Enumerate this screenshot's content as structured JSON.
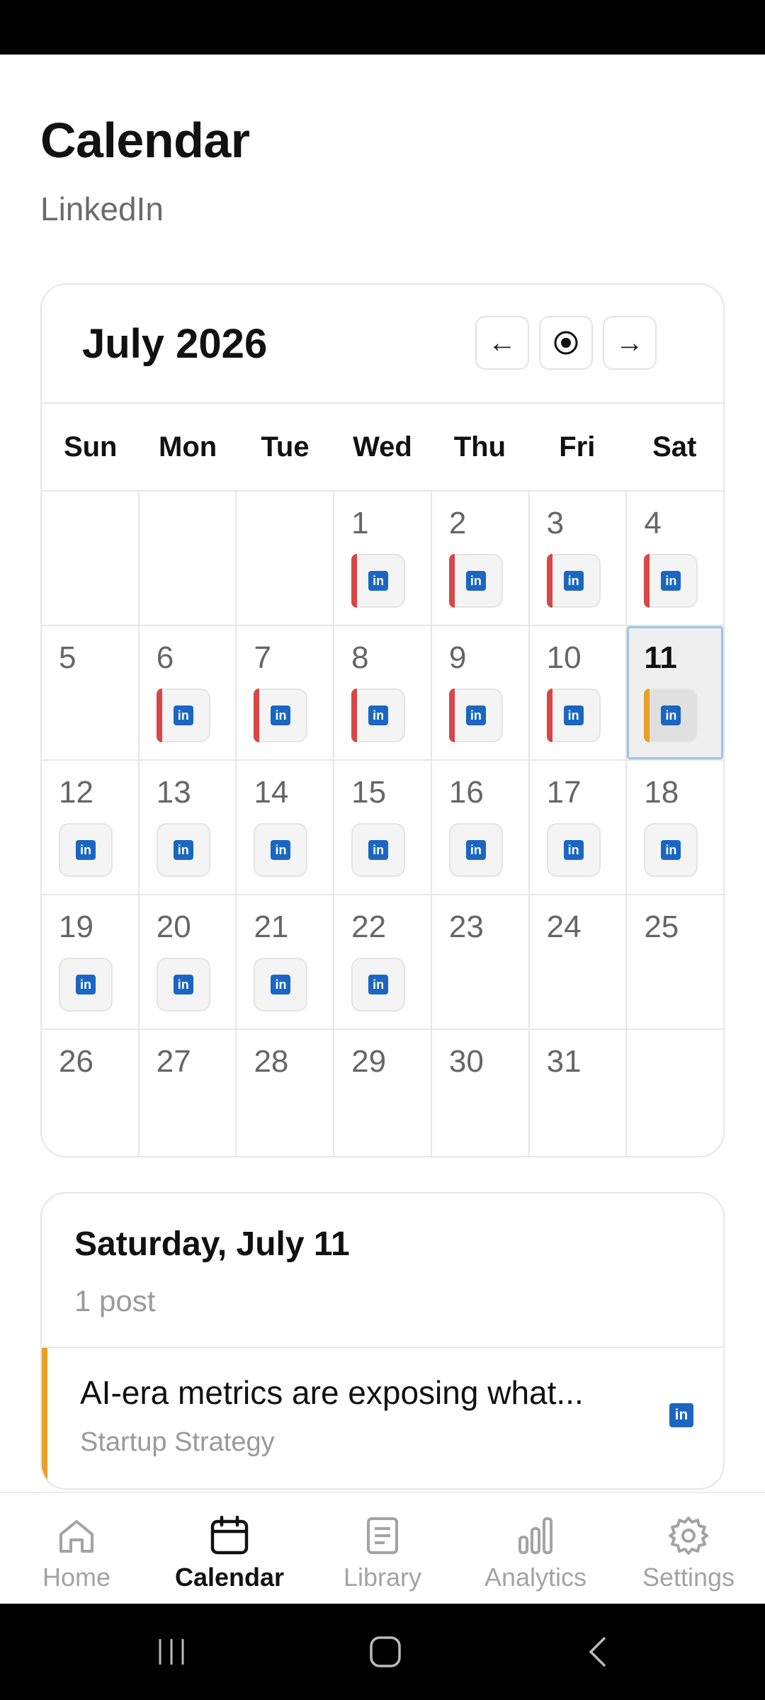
{
  "header": {
    "title": "Calendar",
    "subtitle": "LinkedIn"
  },
  "calendar": {
    "month_label": "July 2026",
    "nav": {
      "prev": "←",
      "today": "⦿",
      "next": "→"
    },
    "weekdays": [
      "Sun",
      "Mon",
      "Tue",
      "Wed",
      "Thu",
      "Fri",
      "Sat"
    ],
    "weeks": [
      [
        "",
        "",
        "",
        "1",
        "2",
        "3",
        "4"
      ],
      [
        "5",
        "6",
        "7",
        "8",
        "9",
        "10",
        "11"
      ],
      [
        "12",
        "13",
        "14",
        "15",
        "16",
        "17",
        "18"
      ],
      [
        "19",
        "20",
        "21",
        "22",
        "23",
        "24",
        "25"
      ],
      [
        "26",
        "27",
        "28",
        "29",
        "30",
        "31",
        ""
      ]
    ],
    "selected_day": "11",
    "chip_label": "in"
  },
  "selected_day_panel": {
    "title": "Saturday, July 11",
    "count": "1 post",
    "posts": [
      {
        "title": "AI-era metrics are exposing what...",
        "category": "Startup Strategy",
        "network_label": "in"
      }
    ]
  },
  "tabs": [
    {
      "label": "Home",
      "icon": "home-icon"
    },
    {
      "label": "Calendar",
      "icon": "calendar-icon"
    },
    {
      "label": "Library",
      "icon": "document-icon"
    },
    {
      "label": "Analytics",
      "icon": "bar-chart-icon"
    },
    {
      "label": "Settings",
      "icon": "gear-icon"
    }
  ],
  "active_tab": "Calendar",
  "colors": {
    "accent_past": "#d94646",
    "accent_today": "#e8a028",
    "linkedin_blue": "#1a66c2",
    "today_outline": "#9cc3ea"
  }
}
